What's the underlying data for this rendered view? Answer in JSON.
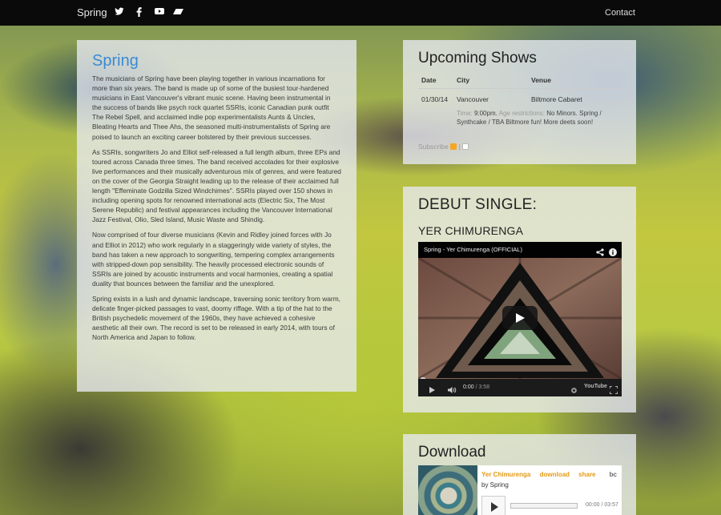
{
  "nav": {
    "brand": "Spring",
    "social": [
      {
        "name": "twitter-icon",
        "glyph": "🐦"
      },
      {
        "name": "facebook-icon",
        "glyph": "f"
      },
      {
        "name": "youtube-icon",
        "glyph": "▶"
      },
      {
        "name": "bandcamp-icon",
        "glyph": "◢"
      }
    ],
    "contact": "Contact"
  },
  "about": {
    "title": "Spring",
    "paragraphs": [
      "The musicians of Spring have been playing together in various incarnations for more than six years. The band is made up of some of the busiest tour-hardened musicians in East Vancouver's vibrant music scene. Having been instrumental in the success of bands like psych rock quartet SSRIs, iconic Canadian punk outfit The Rebel Spell, and acclaimed indie pop experimentalists Aunts & Uncles, Bleating Hearts and Thee Ahs, the seasoned multi-instrumentalists of Spring are poised to launch an exciting career bolstered by their previous successes.",
      "As SSRIs, songwriters Jo and Elliot self-released a full length album, three EPs and toured across Canada three times. The band received accolades for their explosive live performances and their musically adventurous mix of genres, and were featured on the cover of the Georgia Straight leading up to the release of their acclaimed full length \"Effeminate Godzilla Sized Windchimes\". SSRIs played over 150 shows in including opening spots for renowned international acts (Electric Six, The Most Serene Republic) and festival appearances including the Vancouver International Jazz Festival, Olio, Sled Island, Music Waste and Shindig.",
      "Now comprised of four diverse musicians (Kevin and Ridley joined forces with Jo and Elliot in 2012) who work regularly in a staggeringly wide variety of styles, the band has taken a new approach to songwriting, tempering complex arrangements with stripped-down pop sensibility. The heavily processed electronic sounds of SSRIs are joined by acoustic instruments and vocal harmonies, creating a spatial duality that bounces between the familiar and the unexplored.",
      "Spring exists in a lush and dynamic landscape, traversing sonic territory from warm, delicate finger-picked passages to vast, doomy riffage. With a tip of the hat to the British psychedelic movement of the 1960s, they have achieved a cohesive aesthetic all their own. The record is set to be released in early 2014, with tours of North America and Japan to follow."
    ]
  },
  "shows": {
    "title": "Upcoming Shows",
    "columns": [
      "Date",
      "City",
      "Venue"
    ],
    "rows": [
      {
        "date": "01/30/14",
        "city": "Vancouver",
        "venue": "Biltmore Cabaret"
      }
    ],
    "details": {
      "time_label": "Time:",
      "time": "9:00pm.",
      "age_label": "Age restrictions:",
      "age": "No Minors.",
      "notes": "Spring / Synthcake / TBA Biltmore fun! More deets soon!"
    },
    "subscribe": "Subscribe",
    "separator": "|"
  },
  "single": {
    "title": "DEBUT SINGLE:",
    "subtitle": "YER CHIMURENGA",
    "video": {
      "title": "Spring - Yer Chimurenga (OFFICIAL)",
      "time": "0:00",
      "duration": "3:58",
      "platform": "YouTube"
    }
  },
  "download": {
    "title": "Download",
    "player": {
      "track": "Yer Chimurenga",
      "download": "download",
      "share": "share",
      "logo": "bc",
      "by": "by Spring",
      "time": "00:00",
      "duration": "03:57"
    }
  }
}
